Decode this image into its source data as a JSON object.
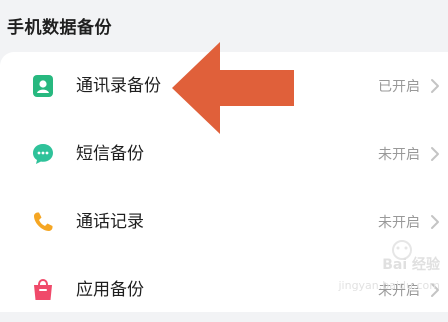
{
  "section": {
    "title": "手机数据备份"
  },
  "items": [
    {
      "label": "通讯录备份",
      "status": "已开启",
      "icon": "contacts-icon",
      "color": "#27b87f"
    },
    {
      "label": "短信备份",
      "status": "未开启",
      "icon": "message-icon",
      "color": "#2fc29a"
    },
    {
      "label": "通话记录",
      "status": "未开启",
      "icon": "phone-icon",
      "color": "#f5a623"
    },
    {
      "label": "应用备份",
      "status": "未开启",
      "icon": "app-bag-icon",
      "color": "#f04a6a"
    }
  ],
  "annotation": {
    "arrow_color": "#e0603a",
    "icon": "left-arrow-icon"
  },
  "watermark": {
    "text": "Bai 经验",
    "sub": "jingyan.baidu.com"
  }
}
